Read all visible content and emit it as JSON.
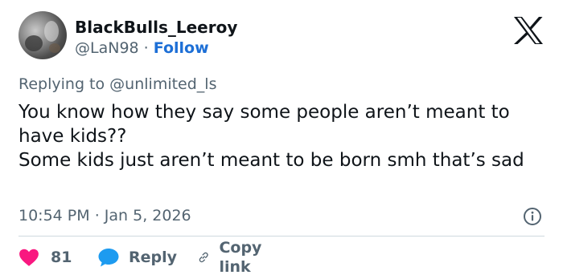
{
  "user": {
    "display_name": "BlackBulls_Leeroy",
    "handle": "@LaN98",
    "separator": "·",
    "follow_label": "Follow"
  },
  "reply_context": {
    "prefix": "Replying to",
    "mention": "@unlimited_ls"
  },
  "tweet": {
    "lines": [
      "You know how they say some people aren’t meant to have kids??",
      "Some kids just aren’t meant to be born smh that’s sad"
    ],
    "time": "10:54 PM",
    "separator": "·",
    "date": "Jan 5, 2026"
  },
  "actions": {
    "like_count": "81",
    "reply_label": "Reply",
    "copy_label": "Copy link"
  },
  "icons": {
    "logo": "x-logo-icon",
    "info": "info-icon",
    "like": "heart-icon",
    "reply": "reply-bubble-icon",
    "copy": "link-icon"
  },
  "colors": {
    "text": "#0f1419",
    "muted": "#536471",
    "link": "#1d6fd6",
    "heart": "#f91880",
    "reply_bubble": "#1d9bf0",
    "divider": "#cfd9de"
  }
}
